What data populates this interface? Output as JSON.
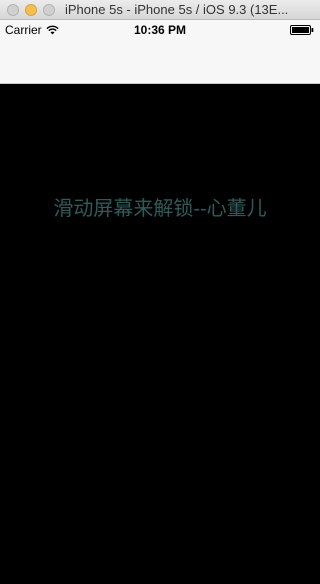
{
  "window": {
    "title": "iPhone 5s - iPhone 5s / iOS 9.3 (13E..."
  },
  "status_bar": {
    "carrier": "Carrier",
    "time": "10:36 PM",
    "wifi_icon": "wifi-icon",
    "battery_icon": "battery-icon"
  },
  "main": {
    "unlock_text": "滑动屏幕来解锁--心董儿",
    "text_color": "#2f5a5a",
    "background_color": "#000000"
  }
}
